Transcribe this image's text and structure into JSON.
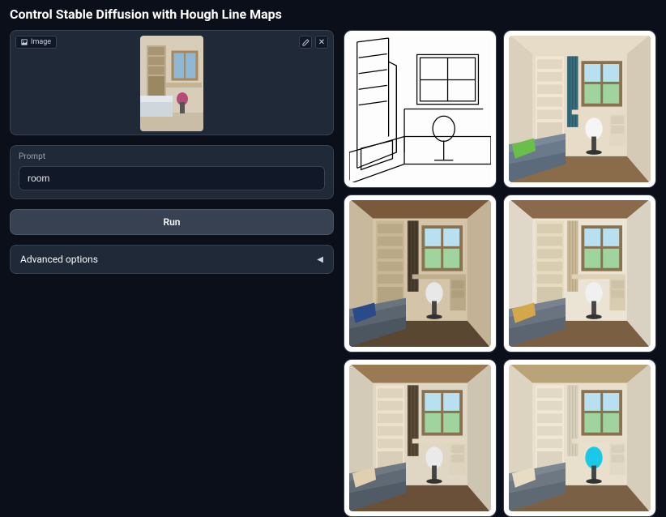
{
  "title": "Control Stable Diffusion with Hough Line Maps",
  "image_upload": {
    "tag_label": "Image",
    "edit_icon": "pencil-icon",
    "close_icon": "close-icon"
  },
  "prompt": {
    "label": "Prompt",
    "value": "room"
  },
  "run_label": "Run",
  "advanced": {
    "label": "Advanced options"
  },
  "results": [
    {
      "kind": "linemap",
      "name": "hough-line-map"
    },
    {
      "kind": "room",
      "name": "generated-room-1",
      "wall": "#e6dcc8",
      "floor": "#8a6b4a",
      "shelf": "#f0e6d2",
      "bed": "#6b7a8a",
      "chair": "#f5f5f5",
      "curtain": "#3a6b7a",
      "pillow": "#6abf4a"
    },
    {
      "kind": "room",
      "name": "generated-room-2",
      "wall": "#d4c4a8",
      "floor": "#5a4732",
      "shelf": "#c9b896",
      "bed": "#5a6570",
      "chair": "#e8e8e8",
      "curtain": "#4a3f30",
      "pillow": "#2a4a8a",
      "ceiling": "#7a5a3a"
    },
    {
      "kind": "room",
      "name": "generated-room-3",
      "wall": "#ebe3d4",
      "floor": "#7a5f42",
      "shelf": "#e8dcc0",
      "bed": "#6a7480",
      "chair": "#f0f0f0",
      "curtain": "#c9b896",
      "pillow": "#d4a84a",
      "ceiling": "#8a6a4a"
    },
    {
      "kind": "room",
      "name": "generated-room-4",
      "wall": "#dfd6c4",
      "floor": "#6a5038",
      "shelf": "#ede3cc",
      "bed": "#5f6a75",
      "chair": "#eaeaea",
      "curtain": "#5a4a38",
      "pillow": "#e0d0b0",
      "ceiling": "#9a7a52"
    },
    {
      "kind": "room",
      "name": "generated-room-5",
      "wall": "#e8e0cc",
      "floor": "#7a6044",
      "shelf": "#f0e8d4",
      "bed": "#6e7882",
      "chair": "#1ac8e8",
      "curtain": "#d8cfba",
      "pillow": "#e8dcc4",
      "ceiling": "#b8a478"
    }
  ]
}
